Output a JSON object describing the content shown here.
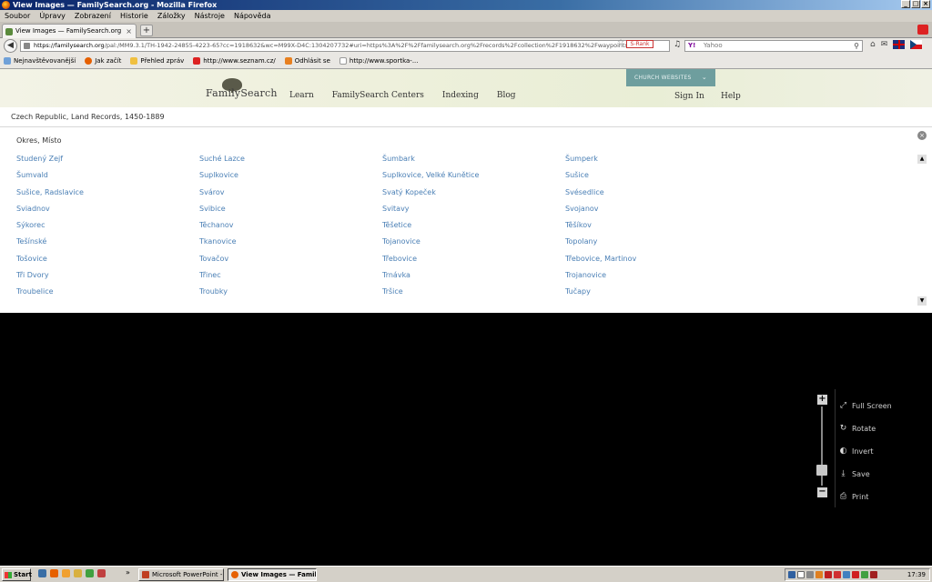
{
  "window": {
    "title": "View Images — FamilySearch.org - Mozilla Firefox"
  },
  "menu": [
    "Soubor",
    "Úpravy",
    "Zobrazení",
    "Historie",
    "Záložky",
    "Nástroje",
    "Nápověda"
  ],
  "tab": {
    "title": "View Images — FamilySearch.org"
  },
  "address": {
    "host": "https://familysearch.org",
    "path": "/pal:/MM9.3.1/TH-1942-24855-4223-65?cc=1918632&wc=M99X-D4C:1304207732#uri=https%3A%2F%2Ffamilysearch.org%2Frecords%2Fcollection%2F1918632%2Fwaypoints",
    "rank_label": "S-Rank"
  },
  "search": {
    "placeholder": "Yahoo",
    "engine_label": "Y!"
  },
  "bookmarks": [
    "Nejnavštěvovanější",
    "Jak začít",
    "Přehled zpráv",
    "http://www.seznam.cz/",
    "Odhlásit se",
    "http://www.sportka-..."
  ],
  "site": {
    "logo": "FamilySearch",
    "nav": [
      "Learn",
      "FamilySearch Centers",
      "Indexing",
      "Blog"
    ],
    "church_button": "CHURCH WEBSITES",
    "sign_in": "Sign In",
    "help": "Help"
  },
  "breadcrumb": "Czech Republic, Land Records, 1450-1889",
  "panel": {
    "title": "Okres, Místo",
    "columns": [
      [
        "Studený Zejf",
        "Šumvald",
        "Sušice, Radslavice",
        "Sviadnov",
        "Sýkorec",
        "Tešínské",
        "Tošovice",
        "Tři Dvory",
        "Troubelice"
      ],
      [
        "Suché Lazce",
        "Suplkovice",
        "Svárov",
        "Svibice",
        "Těchanov",
        "Tkanovice",
        "Tovačov",
        "Třinec",
        "Troubky"
      ],
      [
        "Šumbark",
        "Suplkovice, Velké Kunětice",
        "Svatý Kopeček",
        "Svitavy",
        "Těšetice",
        "Tojanovice",
        "Třebovice",
        "Trnávka",
        "Tršice"
      ],
      [
        "Šumperk",
        "Sušice",
        "Svésedlice",
        "Svojanov",
        "Těšíkov",
        "Topolany",
        "Třebovice, Martinov",
        "Trojanovice",
        "Tučapy"
      ]
    ]
  },
  "viewer": {
    "zoom_level": 0.15,
    "tools": [
      {
        "label": "Full Screen",
        "icon": "fullscreen-icon"
      },
      {
        "label": "Rotate",
        "icon": "rotate-icon"
      },
      {
        "label": "Invert",
        "icon": "invert-icon"
      },
      {
        "label": "Save",
        "icon": "save-icon"
      },
      {
        "label": "Print",
        "icon": "print-icon"
      }
    ]
  },
  "taskbar": {
    "start": "Start",
    "more": "»",
    "tasks": [
      "Microsoft PowerPoint - [...",
      "View Images — Famil..."
    ],
    "clock": "17:39"
  }
}
